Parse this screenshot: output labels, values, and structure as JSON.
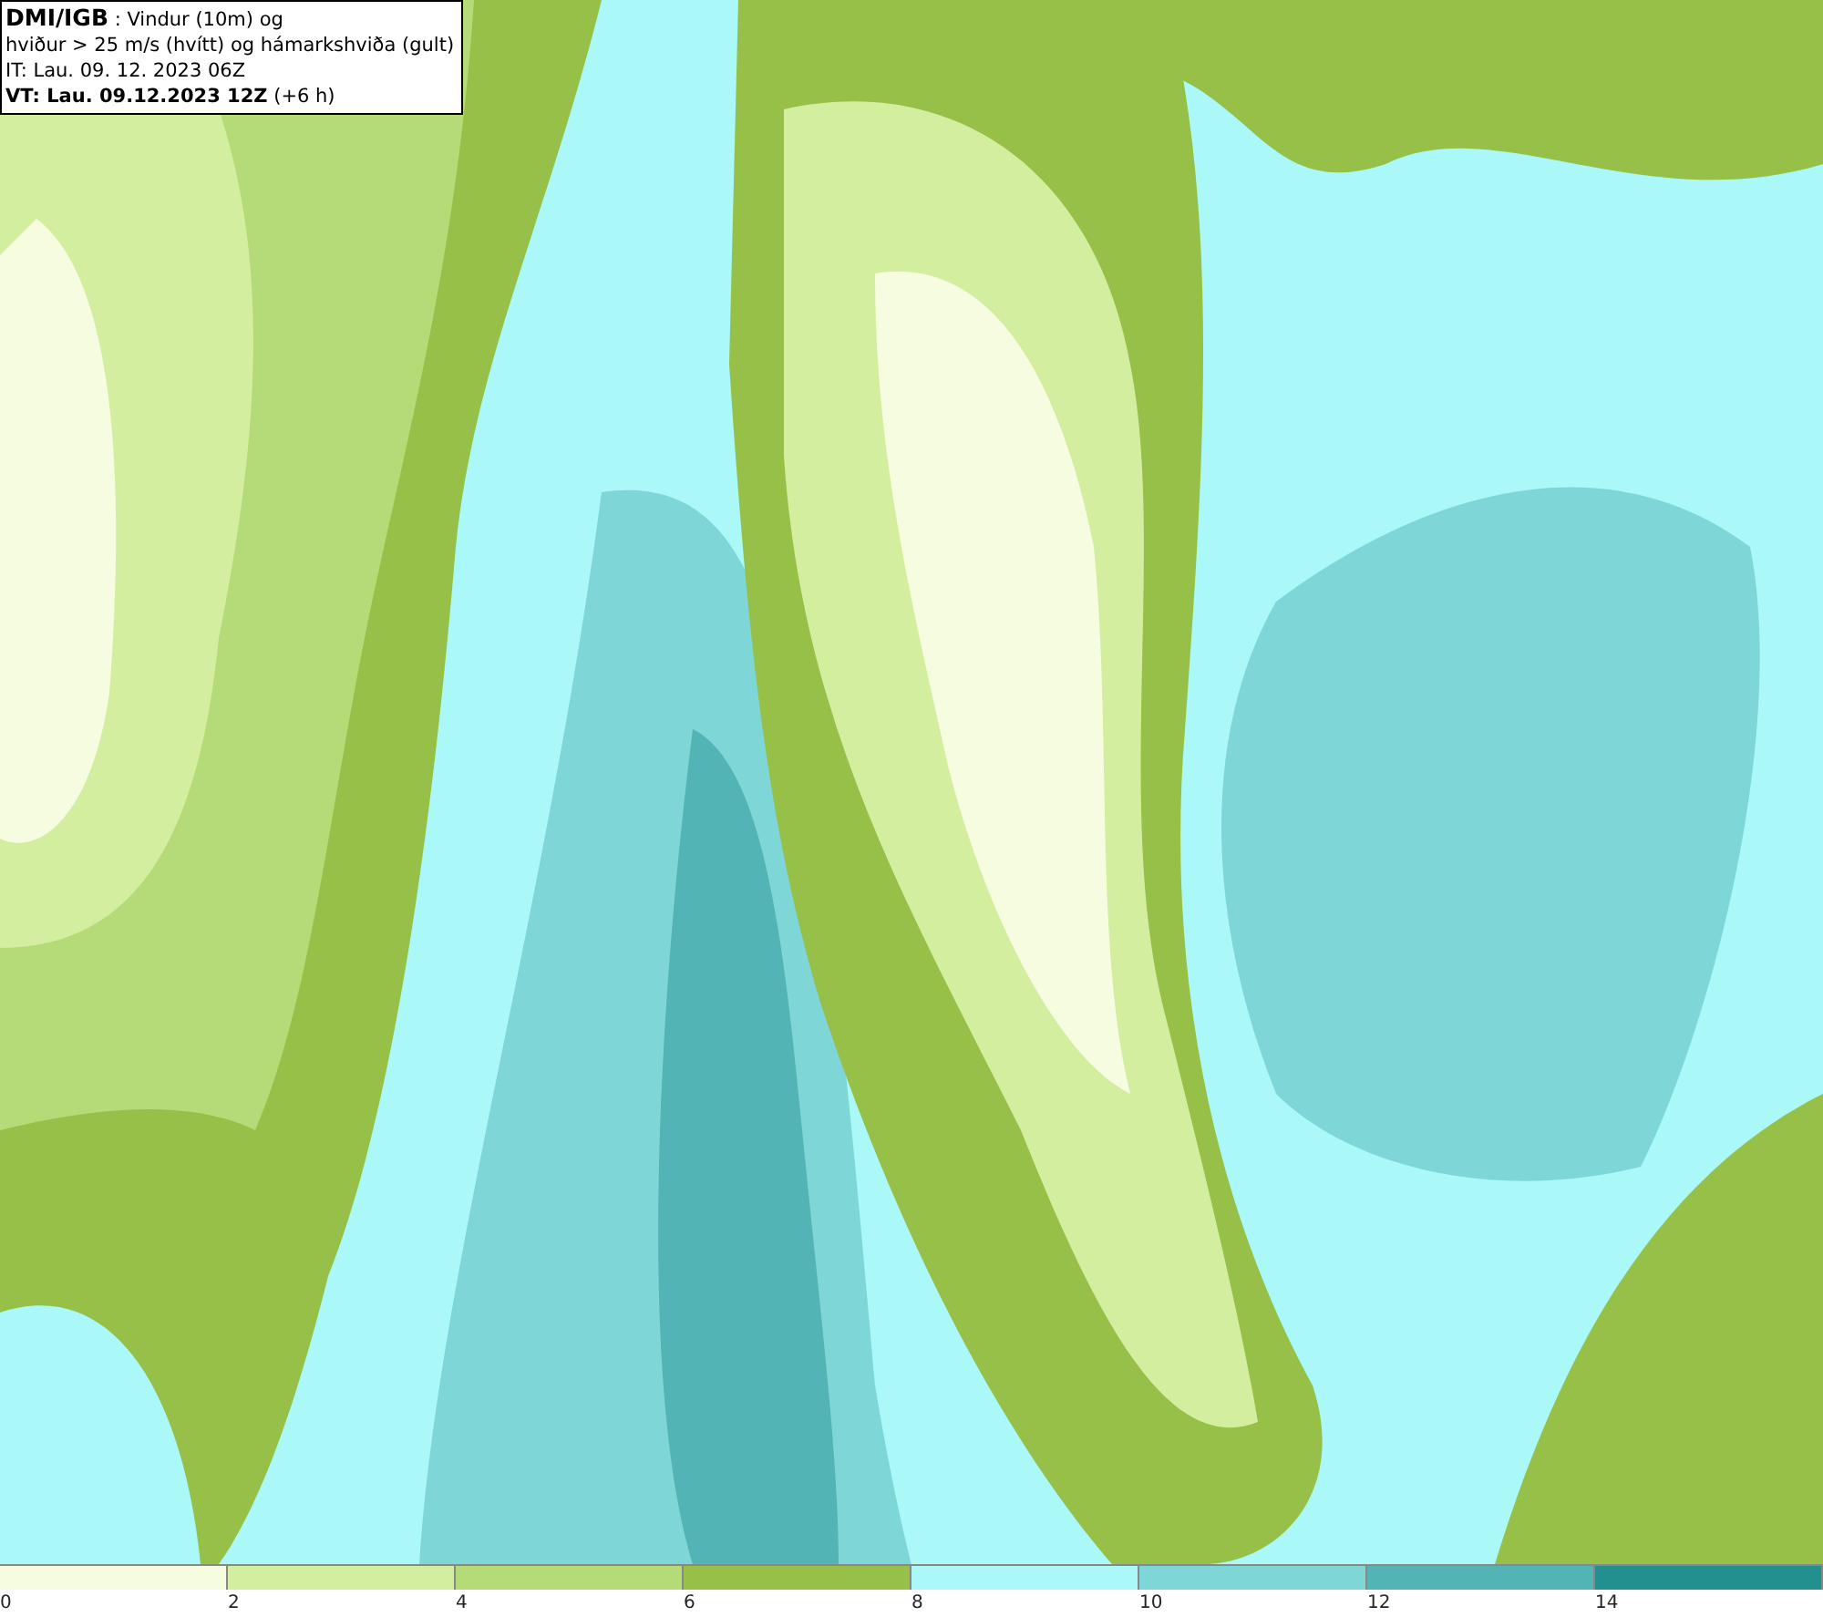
{
  "header": {
    "lines": [
      "**DMI/IGB** : Vindur (10m) og",
      "hviður > 25 m/s (hvítt) og hámarkshviða (gult)",
      "IT: Lau. 09. 12. 2023 06Z",
      "**VT: Lau. 09.12.2023 12Z** (+6 h)"
    ]
  },
  "legend": {
    "bins": [
      {
        "color": "#f5fce0",
        "label": "0"
      },
      {
        "color": "#d4eea0",
        "label": "2"
      },
      {
        "color": "#b5db78",
        "label": "4"
      },
      {
        "color": "#96c048",
        "label": "6"
      },
      {
        "color": "#aaf8f8",
        "label": "8"
      },
      {
        "color": "#7fd6d6",
        "label": "10"
      },
      {
        "color": "#52b4b4",
        "label": "12"
      },
      {
        "color": "#239090",
        "label": "14"
      }
    ]
  }
}
